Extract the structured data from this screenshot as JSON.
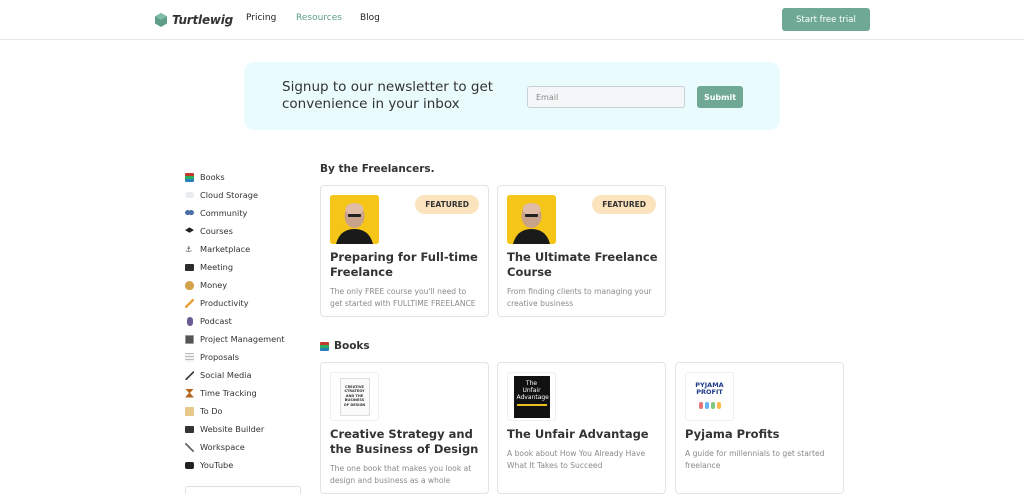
{
  "header": {
    "logo_text": "Turtlewig",
    "nav": [
      "Pricing",
      "Resources",
      "Blog"
    ],
    "cta_label": "Start free trial",
    "colors": {
      "accent": "#6fa996",
      "active_nav": "#5e9e87"
    }
  },
  "newsletter": {
    "heading_line1": "Signup to our newsletter to get",
    "heading_line2": "convenience in your inbox",
    "email_placeholder": "Email",
    "submit_label": "Submit",
    "background": "#e9fbfd"
  },
  "sidebar": {
    "items": [
      {
        "label": "Books",
        "icon": "books-icon"
      },
      {
        "label": "Cloud Storage",
        "icon": "cloud-icon"
      },
      {
        "label": "Community",
        "icon": "people-icon"
      },
      {
        "label": "Courses",
        "icon": "graduation-cap-icon"
      },
      {
        "label": "Marketplace",
        "icon": "anchor-icon"
      },
      {
        "label": "Meeting",
        "icon": "laptop-icon"
      },
      {
        "label": "Money",
        "icon": "money-bag-icon"
      },
      {
        "label": "Productivity",
        "icon": "pencil-icon"
      },
      {
        "label": "Podcast",
        "icon": "microphone-icon"
      },
      {
        "label": "Project Management",
        "icon": "clipboard-icon"
      },
      {
        "label": "Proposals",
        "icon": "document-icon"
      },
      {
        "label": "Social Media",
        "icon": "phone-icon"
      },
      {
        "label": "Time Tracking",
        "icon": "hourglass-icon"
      },
      {
        "label": "To Do",
        "icon": "notepad-icon"
      },
      {
        "label": "Website Builder",
        "icon": "desktop-icon"
      },
      {
        "label": "Workspace",
        "icon": "tools-icon"
      },
      {
        "label": "YouTube",
        "icon": "tv-icon"
      }
    ]
  },
  "sections": {
    "freelancers": {
      "title": "By the Freelancers.",
      "cards": [
        {
          "badge": "FEATURED",
          "title": "Preparing for Full-time Freelance",
          "desc": "The only FREE course you'll need to get started with FULLTIME FREELANCE"
        },
        {
          "badge": "FEATURED",
          "title": "The Ultimate Freelance Course",
          "desc": "From finding clients to managing your creative business"
        }
      ]
    },
    "books": {
      "title": "Books",
      "cards": [
        {
          "title": "Creative Strategy and the Business of Design",
          "desc": "The one book that makes you look at design and business as a whole",
          "cover_text": "CREATIVE STRATEGY AND THE BUSINESS OF DESIGN"
        },
        {
          "title": "The Unfair Advantage",
          "desc": "A book about How You Already Have What It Takes to Succeed",
          "cover_text_line1": "The",
          "cover_text_line2": "Unfair",
          "cover_text_line3": "Advantage"
        },
        {
          "title": "Pyjama Profits",
          "desc": "A guide for millennials to get started freelance",
          "cover_text_line1": "PYJAMA",
          "cover_text_line2": "PROFIT"
        }
      ]
    }
  },
  "colors": {
    "badge_bg": "#fbe3bd",
    "thumb_yellow": "#f5c518"
  }
}
